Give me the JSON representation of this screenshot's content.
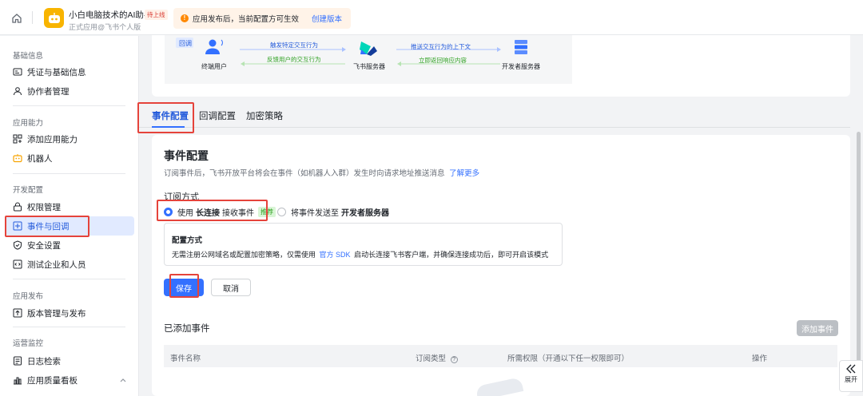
{
  "topbar": {
    "app_title": "小白电脑技术的AI助手",
    "status_tag": "待上线",
    "app_subtitle": "正式应用@飞书个人版",
    "notice_text": "应用发布后，当前配置方可生效",
    "notice_link": "创建版本"
  },
  "sidebar": {
    "sections": [
      {
        "title": "基础信息",
        "items": [
          {
            "label": "凭证与基础信息",
            "icon": "credential-icon"
          },
          {
            "label": "协作者管理",
            "icon": "user-icon"
          }
        ]
      },
      {
        "title": "应用能力",
        "items": [
          {
            "label": "添加应用能力",
            "icon": "grid-plus-icon"
          },
          {
            "label": "机器人",
            "icon": "robot-icon"
          }
        ]
      },
      {
        "title": "开发配置",
        "items": [
          {
            "label": "权限管理",
            "icon": "lock-icon"
          },
          {
            "label": "事件与回调",
            "icon": "event-icon",
            "active": true
          },
          {
            "label": "安全设置",
            "icon": "shield-icon"
          },
          {
            "label": "测试企业和人员",
            "icon": "code-icon"
          }
        ]
      },
      {
        "title": "应用发布",
        "items": [
          {
            "label": "版本管理与发布",
            "icon": "upload-icon"
          }
        ]
      },
      {
        "title": "运营监控",
        "items": [
          {
            "label": "日志检索",
            "icon": "log-icon"
          },
          {
            "label": "应用质量看板",
            "icon": "chart-icon"
          }
        ]
      }
    ]
  },
  "diagram": {
    "tag": "回调",
    "left_node": "终端用户",
    "middle_node": "飞书服务器",
    "right_node": "开发者服务器",
    "arrow_1": "触发特定交互行为",
    "arrow_2": "反馈用户的交互行为",
    "arrow_3": "推送交互行为的上下文",
    "arrow_4": "立即返回响应内容"
  },
  "tabs": [
    {
      "label": "事件配置",
      "active": true
    },
    {
      "label": "回调配置"
    },
    {
      "label": "加密策略"
    }
  ],
  "event_config": {
    "title": "事件配置",
    "description": "订阅事件后，飞书开放平台将会在事件（如机器人入群）发生时向请求地址推送消息",
    "learn_more": "了解更多",
    "subscribe_label": "订阅方式",
    "option1_prefix": "使用",
    "option1_bold": "长连接",
    "option1_suffix": "接收事件",
    "option1_tag": "推荐",
    "option2_prefix": "将事件发送至",
    "option2_bold": "开发者服务器",
    "config_title": "配置方式",
    "config_desc_1": "无需注册公网域名或配置加密策略，仅需使用",
    "config_link": "官方 SDK",
    "config_desc_2": "启动长连接飞书客户端，并确保连接成功后，即可开启该模式",
    "save_label": "保存",
    "cancel_label": "取消"
  },
  "added_events": {
    "title": "已添加事件",
    "add_button": "添加事件",
    "columns": [
      "事件名称",
      "订阅类型",
      "所需权限（开通以下任一权限即可）",
      "操作"
    ]
  },
  "expand_label": "展开",
  "colors": {
    "accent": "#3370ff",
    "highlight_red": "#e5433b",
    "active_bg": "#e1eaff"
  }
}
